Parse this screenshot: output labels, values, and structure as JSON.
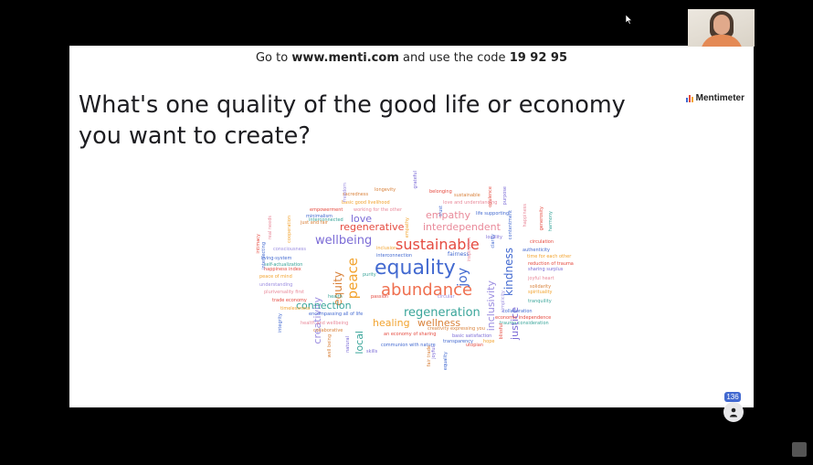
{
  "colors": {
    "bg": "#000000",
    "slide": "#ffffff",
    "accent": "#4269d0"
  },
  "header": {
    "code_prefix": "Go to ",
    "url": "www.menti.com",
    "code_mid": " and use the code ",
    "code": "19 92 95"
  },
  "question": "What's one quality of the good life or economy you want to create?",
  "brand": "Mentimeter",
  "participants": "136",
  "icons": {
    "user": "person-icon",
    "cursor": "mouse-pointer-icon",
    "logo": "mentimeter-bars-icon"
  },
  "words": [
    {
      "t": "equality",
      "c": "#4269d0"
    },
    {
      "t": "abundance",
      "c": "#ef6f4f"
    },
    {
      "t": "sustainable",
      "c": "#e54a3f"
    },
    {
      "t": "wellbeing",
      "c": "#7b6bd6"
    },
    {
      "t": "regeneration",
      "c": "#3aa59a"
    },
    {
      "t": "peace",
      "c": "#f2a32e"
    },
    {
      "t": "equity",
      "c": "#d9823b"
    },
    {
      "t": "creativity",
      "c": "#9b8de0"
    },
    {
      "t": "joy",
      "c": "#4269d0"
    },
    {
      "t": "kindness",
      "c": "#4269d0"
    },
    {
      "t": "inclusivity",
      "c": "#9b8de0"
    },
    {
      "t": "justice",
      "c": "#7b6bd6"
    },
    {
      "t": "connection",
      "c": "#3aa59a"
    },
    {
      "t": "empathy",
      "c": "#e98a9a"
    },
    {
      "t": "interdependent",
      "c": "#e98a9a"
    },
    {
      "t": "regenerative",
      "c": "#e54a3f"
    },
    {
      "t": "love",
      "c": "#7b6bd6"
    },
    {
      "t": "healing",
      "c": "#f2a32e"
    },
    {
      "t": "wellness",
      "c": "#d9823b"
    },
    {
      "t": "local",
      "c": "#3aa59a"
    },
    {
      "t": "fairness",
      "c": "#4269d0"
    },
    {
      "t": "longevity",
      "c": "#d9823b"
    },
    {
      "t": "belonging",
      "c": "#e54a3f"
    },
    {
      "t": "sustainable",
      "c": "#d9823b"
    },
    {
      "t": "love and understanding",
      "c": "#e98a9a"
    },
    {
      "t": "life supporting",
      "c": "#4269d0"
    },
    {
      "t": "sacredness",
      "c": "#d9823b"
    },
    {
      "t": "basic good livelihood",
      "c": "#f2a32e"
    },
    {
      "t": "working for the other",
      "c": "#e98a9a"
    },
    {
      "t": "empowerment",
      "c": "#e54a3f"
    },
    {
      "t": "minimalism",
      "c": "#4269d0"
    },
    {
      "t": "interconnected",
      "c": "#3aa59a"
    },
    {
      "t": "just and fair",
      "c": "#d9823b"
    },
    {
      "t": "locality",
      "c": "#7b6bd6"
    },
    {
      "t": "circulation",
      "c": "#e54a3f"
    },
    {
      "t": "authenticity",
      "c": "#4269d0"
    },
    {
      "t": "time for each other",
      "c": "#f2a32e"
    },
    {
      "t": "reduction of trauma",
      "c": "#e54a3f"
    },
    {
      "t": "sharing surplus",
      "c": "#7b6bd6"
    },
    {
      "t": "joyful heart",
      "c": "#e98a9a"
    },
    {
      "t": "solidarity",
      "c": "#d9823b"
    },
    {
      "t": "spirituality",
      "c": "#f2a32e"
    },
    {
      "t": "tranquility",
      "c": "#3aa59a"
    },
    {
      "t": "consciousness",
      "c": "#9b8de0"
    },
    {
      "t": "living-system",
      "c": "#4269d0"
    },
    {
      "t": "self-actualization",
      "c": "#3aa59a"
    },
    {
      "t": "happiness index",
      "c": "#e54a3f"
    },
    {
      "t": "peace of mind",
      "c": "#f2a32e"
    },
    {
      "t": "understanding",
      "c": "#9b8de0"
    },
    {
      "t": "pluriversality first",
      "c": "#e98a9a"
    },
    {
      "t": "trade economy",
      "c": "#e54a3f"
    },
    {
      "t": "timelessness",
      "c": "#f2a32e"
    },
    {
      "t": "encompassing all of life",
      "c": "#4269d0"
    },
    {
      "t": "health and wellbeing",
      "c": "#e98a9a"
    },
    {
      "t": "collaborative",
      "c": "#d9823b"
    },
    {
      "t": "inclusion",
      "c": "#f2a32e"
    },
    {
      "t": "interconnection",
      "c": "#4269d0"
    },
    {
      "t": "purity",
      "c": "#3aa59a"
    },
    {
      "t": "health",
      "c": "#3aa59a"
    },
    {
      "t": "passion",
      "c": "#e54a3f"
    },
    {
      "t": "circular",
      "c": "#9b8de0"
    },
    {
      "t": "collaboration",
      "c": "#4269d0"
    },
    {
      "t": "economic independence",
      "c": "#e54a3f"
    },
    {
      "t": "trauma consideration",
      "c": "#3aa59a"
    },
    {
      "t": "creativity expressing you",
      "c": "#d9823b"
    },
    {
      "t": "an economy of sharing",
      "c": "#e54a3f"
    },
    {
      "t": "basic satisfaction",
      "c": "#7b6bd6"
    },
    {
      "t": "transparency",
      "c": "#4269d0"
    },
    {
      "t": "hope",
      "c": "#f2a32e"
    },
    {
      "t": "communion with nature",
      "c": "#4269d0"
    },
    {
      "t": "utopian",
      "c": "#e54a3f"
    },
    {
      "t": "skills",
      "c": "#7b6bd6"
    },
    {
      "t": "freedom",
      "c": "#9b8de0"
    },
    {
      "t": "intimacy",
      "c": "#e54a3f"
    },
    {
      "t": "intersecting",
      "c": "#4269d0"
    },
    {
      "t": "cooperation",
      "c": "#f2a32e"
    },
    {
      "t": "real needs",
      "c": "#e98a9a"
    },
    {
      "t": "trust",
      "c": "#4269d0"
    },
    {
      "t": "empathy",
      "c": "#f2a32e"
    },
    {
      "t": "grateful",
      "c": "#7b6bd6"
    },
    {
      "t": "blissful",
      "c": "#e54a3f"
    },
    {
      "t": "integrity",
      "c": "#4269d0"
    },
    {
      "t": "natural",
      "c": "#7b6bd6"
    },
    {
      "t": "well being",
      "c": "#d9823b"
    },
    {
      "t": "fair trade",
      "c": "#d9823b"
    },
    {
      "t": "joyful",
      "c": "#7b6bd6"
    },
    {
      "t": "equality",
      "c": "#4269d0"
    },
    {
      "t": "inspiration",
      "c": "#e98a9a"
    },
    {
      "t": "opulence",
      "c": "#e54a3f"
    },
    {
      "t": "purpose",
      "c": "#7b6bd6"
    },
    {
      "t": "happiness",
      "c": "#e98a9a"
    },
    {
      "t": "generosity",
      "c": "#e54a3f"
    },
    {
      "t": "harmony",
      "c": "#3aa59a"
    },
    {
      "t": "contentment",
      "c": "#4269d0"
    },
    {
      "t": "clarity",
      "c": "#4269d0"
    },
    {
      "t": "simplicity",
      "c": "#9b8de0"
    }
  ]
}
